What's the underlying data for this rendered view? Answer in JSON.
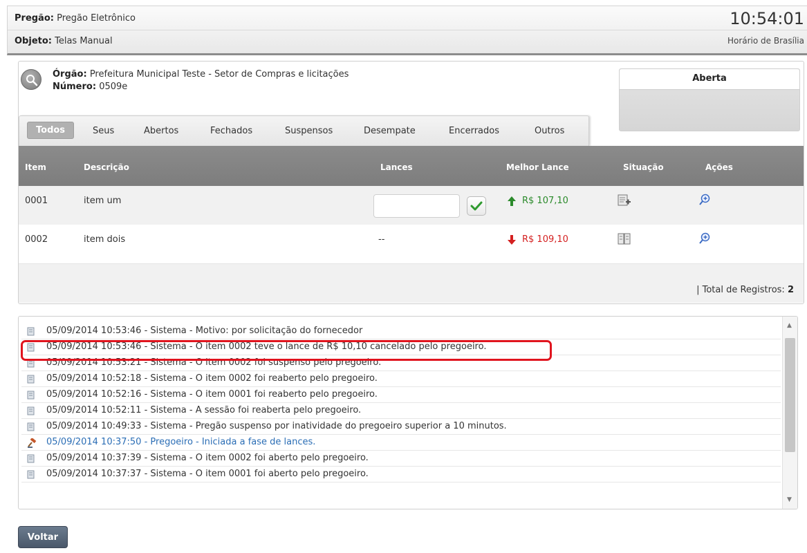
{
  "header": {
    "pregao_label": "Pregão:",
    "pregao_value": "Pregão Eletrônico",
    "objeto_label": "Objeto:",
    "objeto_value": "Telas Manual",
    "time": "10:54:01",
    "time_zone": "Horário de Brasília"
  },
  "info": {
    "orgao_label": "Órgão:",
    "orgao_value": "Prefeitura Municipal Teste - Setor de Compras e licitações",
    "numero_label": "Número:",
    "numero_value": "0509e"
  },
  "status": {
    "label": "Aberta"
  },
  "tabs": [
    "Todos",
    "Seus",
    "Abertos",
    "Fechados",
    "Suspensos",
    "Desempate",
    "Encerrados",
    "Outros"
  ],
  "table": {
    "headers": [
      "Item",
      "Descrição",
      "Lances",
      "Melhor Lance",
      "Situação",
      "Ações"
    ],
    "rows": [
      {
        "item": "0001",
        "descricao": "item um",
        "lance_input": "",
        "melhor_lance": "R$ 107,10",
        "trend": "up"
      },
      {
        "item": "0002",
        "descricao": "item dois",
        "lances": "--",
        "melhor_lance": "R$ 109,10",
        "trend": "down"
      }
    ],
    "total_label": "| Total de Registros:",
    "total_value": "2"
  },
  "log": [
    {
      "text": "05/09/2014 10:53:46 - Sistema - Motivo: por solicitação do fornecedor",
      "source": "sistema"
    },
    {
      "text": "05/09/2014 10:53:46 - Sistema - O item 0002 teve o lance de R$ 10,10 cancelado pelo pregoeiro.",
      "source": "sistema"
    },
    {
      "text": "05/09/2014 10:53:21 - Sistema - O item 0002 foi suspenso pelo pregoeiro.",
      "source": "sistema"
    },
    {
      "text": "05/09/2014 10:52:18 - Sistema - O item 0002 foi reaberto pelo pregoeiro.",
      "source": "sistema"
    },
    {
      "text": "05/09/2014 10:52:16 - Sistema - O item 0001 foi reaberto pelo pregoeiro.",
      "source": "sistema"
    },
    {
      "text": "05/09/2014 10:52:11 - Sistema - A sessão foi reaberta pelo pregoeiro.",
      "source": "sistema"
    },
    {
      "text": "05/09/2014 10:49:33 - Sistema - Pregão suspenso por inatividade do pregoeiro superior a 10 minutos.",
      "source": "sistema"
    },
    {
      "text": "05/09/2014 10:37:50 - Pregoeiro - Iniciada a fase de lances.",
      "source": "pregoeiro"
    },
    {
      "text": "05/09/2014 10:37:39 - Sistema - O item 0002 foi aberto pelo pregoeiro.",
      "source": "sistema"
    },
    {
      "text": "05/09/2014 10:37:37 - Sistema - O item 0001 foi aberto pelo pregoeiro.",
      "source": "sistema"
    }
  ],
  "buttons": {
    "voltar": "Voltar"
  },
  "colors": {
    "price_up": "#2b8a2b",
    "price_down": "#d42020",
    "highlight": "#e0141e",
    "header_row": "#858585"
  }
}
